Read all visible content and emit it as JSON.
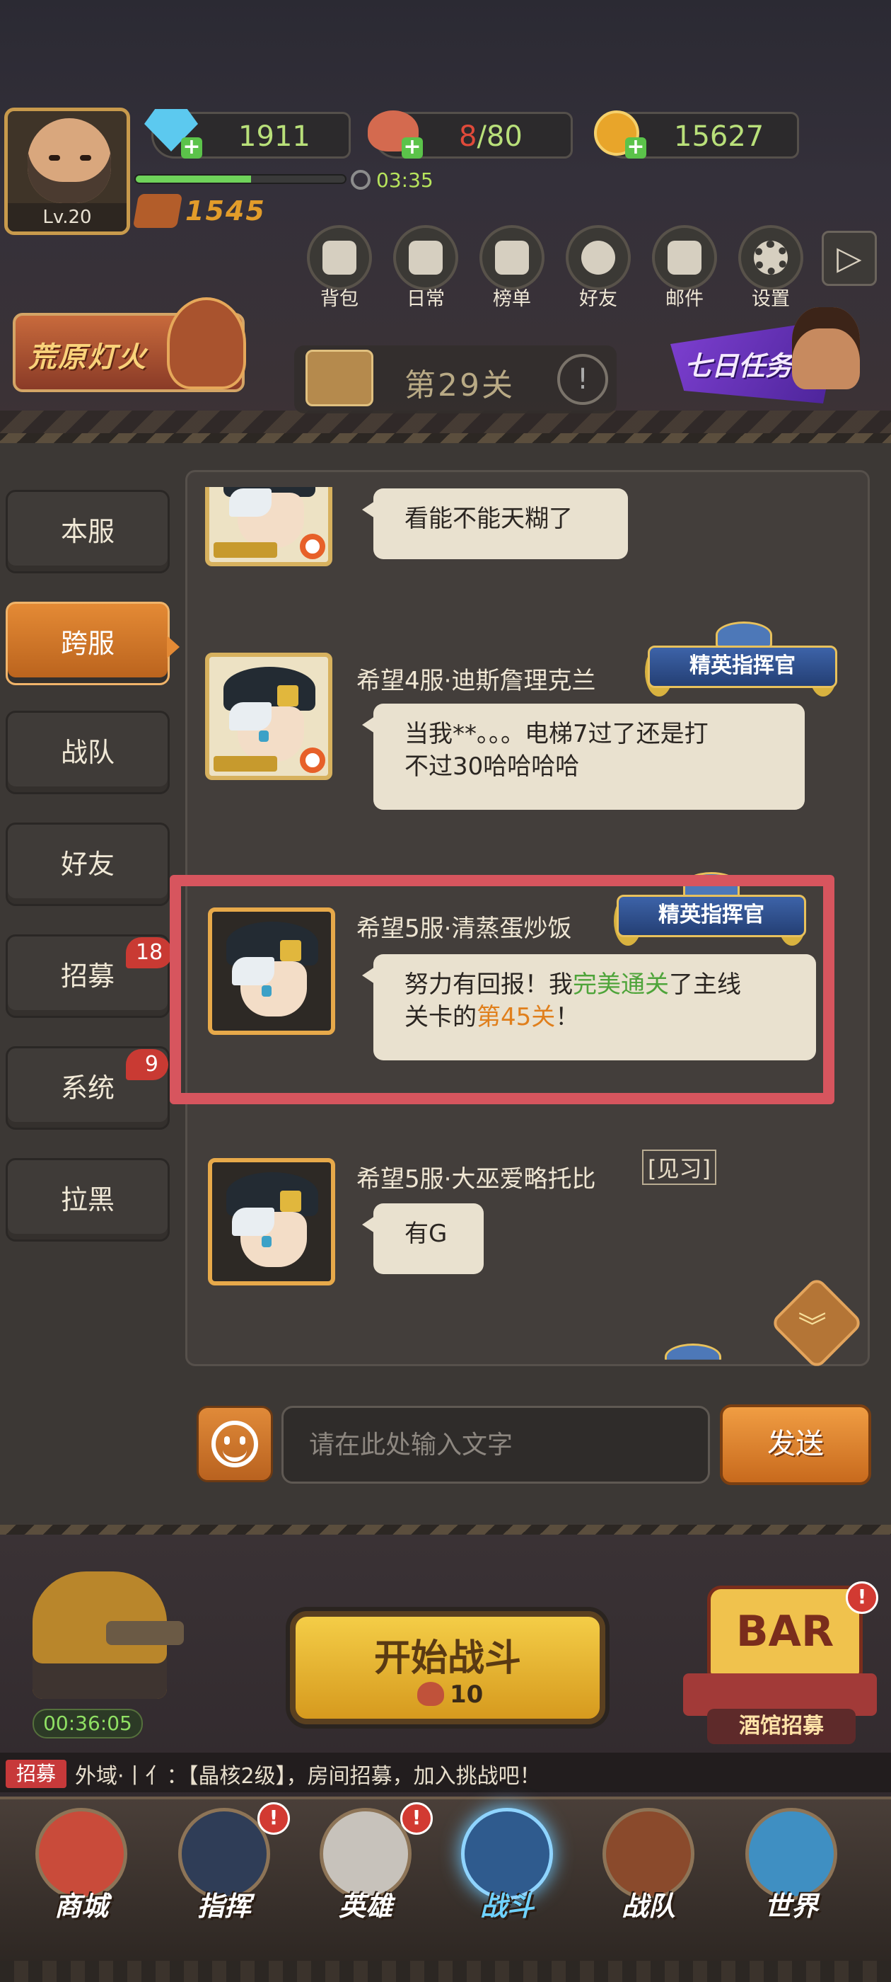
{
  "player": {
    "level": "Lv.20",
    "power": "1545",
    "timer": "03:35",
    "exp_fraction": 0.55
  },
  "resources": {
    "diamond": "1911",
    "stamina": "8",
    "stamina_max": "/80",
    "gold": "15627"
  },
  "top_menu": [
    {
      "label": "背包",
      "icon": "backpack-icon"
    },
    {
      "label": "日常",
      "icon": "daily-box-icon"
    },
    {
      "label": "榜单",
      "icon": "podium-icon"
    },
    {
      "label": "好友",
      "icon": "friend-icon"
    },
    {
      "label": "邮件",
      "icon": "mail-icon"
    },
    {
      "label": "设置",
      "icon": "gear-icon"
    }
  ],
  "events": {
    "left_banner": "荒原灯火",
    "stage": "第29关",
    "right_banner": "七日任务"
  },
  "chat_tabs": [
    {
      "label": "本服",
      "badge": ""
    },
    {
      "label": "跨服",
      "badge": ""
    },
    {
      "label": "战队",
      "badge": ""
    },
    {
      "label": "好友",
      "badge": ""
    },
    {
      "label": "招募",
      "badge": "18"
    },
    {
      "label": "系统",
      "badge": "9"
    },
    {
      "label": "拉黑",
      "badge": ""
    }
  ],
  "messages": [
    {
      "name": "",
      "title": "",
      "text": "看能不能天糊了"
    },
    {
      "name": "希望4服·迪斯詹理克兰",
      "title": "精英指挥官",
      "text_line1": "当我**。。。电梯7过了还是打",
      "text_line2": "不过30哈哈哈哈"
    },
    {
      "name": "希望5服·清蒸蛋炒饭",
      "title": "精英指挥官",
      "text_pre": "努力有回报！我",
      "text_green": "完美通关",
      "text_mid": "了主线",
      "text_line2_pre": "关卡的",
      "text_orange": "第45关",
      "text_end": "！"
    },
    {
      "name": "希望5服·大巫爱略托比",
      "tag": "[见习]",
      "text": "有G"
    }
  ],
  "input": {
    "placeholder": "请在此处输入文字",
    "send_label": "发送"
  },
  "lower": {
    "idle_timer": "00:36:05",
    "start_label": "开始战斗",
    "start_cost": "10",
    "bar_sign": "BAR",
    "bar_label": "酒馆招募",
    "bar_alert": "!"
  },
  "ticker": {
    "tag": "招募",
    "text": "外域·丨亻：【晶核2级】，房间招募，加入挑战吧！"
  },
  "bottom_nav": [
    {
      "label": "商城",
      "alert": ""
    },
    {
      "label": "指挥",
      "alert": "!"
    },
    {
      "label": "英雄",
      "alert": "!"
    },
    {
      "label": "战斗",
      "alert": ""
    },
    {
      "label": "战队",
      "alert": ""
    },
    {
      "label": "世界",
      "alert": ""
    }
  ],
  "colors": {
    "accent_orange": "#e48a35",
    "highlight_frame": "#d7555e",
    "green_text": "#4ea43a",
    "orange_text": "#e07f1c"
  }
}
